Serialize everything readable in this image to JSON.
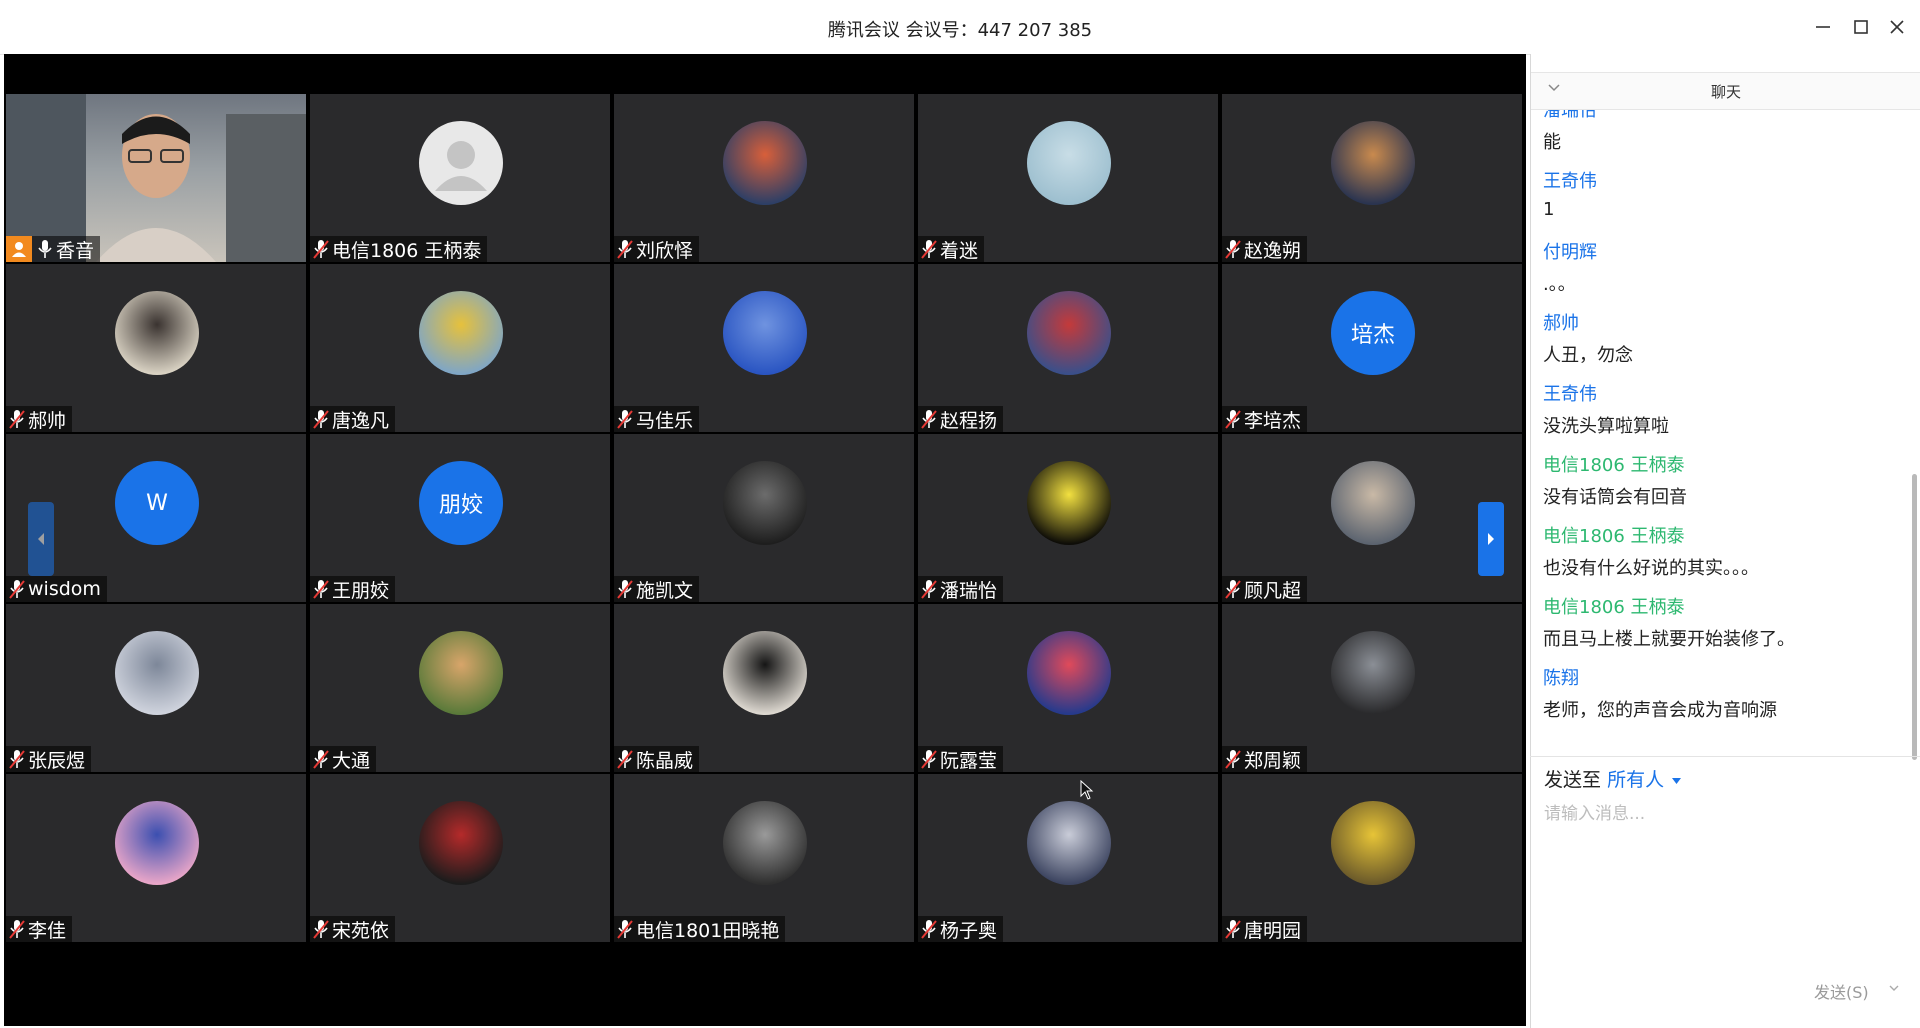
{
  "window": {
    "title": "腾讯会议 会议号：447 207 385",
    "icons": [
      "minimize-icon",
      "maximize-icon",
      "close-icon"
    ]
  },
  "participants": [
    {
      "name": "香音",
      "kind": "video",
      "host": true
    },
    {
      "name": "电信1806 王柄泰",
      "kind": "default"
    },
    {
      "name": "刘欣怿",
      "kind": "photo",
      "colors": [
        "#2d3f66",
        "#d85f3a"
      ]
    },
    {
      "name": "着迷",
      "kind": "photo",
      "colors": [
        "#9dbfcf",
        "#c8dde6"
      ]
    },
    {
      "name": "赵逸朔",
      "kind": "photo",
      "colors": [
        "#2a3450",
        "#c98a4e"
      ]
    },
    {
      "name": "郝帅",
      "kind": "photo",
      "colors": [
        "#d9d2c3",
        "#3a3330"
      ]
    },
    {
      "name": "唐逸凡",
      "kind": "photo",
      "colors": [
        "#7fa6c6",
        "#e6c13c"
      ]
    },
    {
      "name": "马佳乐",
      "kind": "photo",
      "colors": [
        "#2a55c2",
        "#6f93e0"
      ]
    },
    {
      "name": "赵程扬",
      "kind": "photo",
      "colors": [
        "#3a4f8a",
        "#c43a3a"
      ]
    },
    {
      "name": "李培杰",
      "kind": "text",
      "initials": "培杰"
    },
    {
      "name": "wisdom",
      "kind": "text",
      "initials": "W"
    },
    {
      "name": "王朋姣",
      "kind": "text",
      "initials": "朋姣"
    },
    {
      "name": "施凯文",
      "kind": "photo",
      "colors": [
        "#1e1e1e",
        "#6c6c6c"
      ]
    },
    {
      "name": "潘瑞怡",
      "kind": "photo",
      "colors": [
        "#0e0d08",
        "#f2e040"
      ]
    },
    {
      "name": "顾凡超",
      "kind": "photo",
      "colors": [
        "#5c6470",
        "#c9b9a6"
      ]
    },
    {
      "name": "张辰煜",
      "kind": "photo",
      "colors": [
        "#cfd3dd",
        "#7d8799"
      ]
    },
    {
      "name": "大通",
      "kind": "photo",
      "colors": [
        "#5a7a3a",
        "#d8a56a"
      ]
    },
    {
      "name": "陈晶威",
      "kind": "photo",
      "colors": [
        "#ddd8d0",
        "#151515"
      ]
    },
    {
      "name": "阮露莹",
      "kind": "photo",
      "colors": [
        "#263a8c",
        "#e04a5a"
      ]
    },
    {
      "name": "郑周颖",
      "kind": "photo",
      "colors": [
        "#2a2a2c",
        "#8b8f96"
      ]
    },
    {
      "name": "李佳",
      "kind": "photo",
      "colors": [
        "#e9a6c8",
        "#3b4fb0"
      ]
    },
    {
      "name": "宋苑依",
      "kind": "photo",
      "colors": [
        "#1c1c1c",
        "#b52a2a"
      ]
    },
    {
      "name": "电信1801田晓艳",
      "kind": "photo",
      "colors": [
        "#2f2f2f",
        "#9a9a9a"
      ]
    },
    {
      "name": "杨子奥",
      "kind": "photo",
      "colors": [
        "#3c4460",
        "#c9ccd8"
      ]
    },
    {
      "name": "唐明园",
      "kind": "photo",
      "colors": [
        "#6b5a2a",
        "#e7c437"
      ]
    }
  ],
  "chat": {
    "title": "聊天",
    "messages": [
      {
        "sender": "潘瑞怡",
        "text": "能",
        "color": "#1a73e8"
      },
      {
        "sender": "王奇伟",
        "text": "1",
        "color": "#1a73e8"
      },
      {
        "sender": "付明辉",
        "text": ".。。",
        "color": "#1a73e8"
      },
      {
        "sender": "郝帅",
        "text": "人丑，勿念",
        "color": "#1a73e8"
      },
      {
        "sender": "王奇伟",
        "text": "没洗头算啦算啦",
        "color": "#1a73e8"
      },
      {
        "sender": "电信1806 王柄泰",
        "text": "没有话筒会有回音",
        "color": "#2db870"
      },
      {
        "sender": "电信1806 王柄泰",
        "text": "也没有什么好说的其实。。。",
        "color": "#2db870"
      },
      {
        "sender": "电信1806 王柄泰",
        "text": "而且马上楼上就要开始装修了。",
        "color": "#2db870"
      },
      {
        "sender": "陈翔",
        "text": "老师，您的声音会成为音响源",
        "color": "#1a73e8"
      }
    ],
    "send_to_label": "发送至",
    "send_to_target": "所有人",
    "input_placeholder": "请输入消息...",
    "send_button": "发送(S)"
  },
  "colors": {
    "accent": "#1a73e8",
    "self_chat": "#2db870",
    "host_badge": "#f28a1f",
    "tile_bg": "#2a2a2c"
  }
}
